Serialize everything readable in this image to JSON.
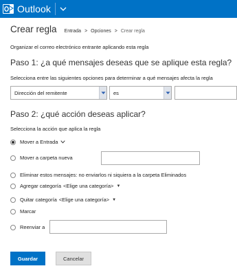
{
  "header": {
    "app_name": "Outlook"
  },
  "page": {
    "title": "Crear regla",
    "breadcrumb": [
      "Entrada",
      "Opciones",
      "Crear regla"
    ],
    "breadcrumb_sep": ">",
    "intro": "Organizar el correo electrónico entrante aplicando esta regla"
  },
  "step1": {
    "heading": "Paso 1: ¿a qué mensajes deseas que se aplique esta regla?",
    "instruction": "Selecciona entre las siguientes opciones para determinar a qué mensajes afecta la regla",
    "field_select": "Dirección del remitente",
    "operator_select": "es",
    "value": ""
  },
  "step2": {
    "heading": "Paso 2: ¿qué acción deseas aplicar?",
    "instruction": "Selecciona la acción que aplica la regla",
    "options": [
      {
        "label": "Mover a Entrada",
        "selected": true
      },
      {
        "label": "Mover a carpeta nueva",
        "selected": false
      },
      {
        "label": "Eliminar estos mensajes: no enviarlos ni siquiera a la carpeta Eliminados",
        "selected": false
      },
      {
        "label": "Agregar categoría",
        "link": "<Elige una categoría>",
        "selected": false
      },
      {
        "label": "Quitar categoría",
        "link": "<Elige una categoría>",
        "selected": false
      },
      {
        "label": "Marcar",
        "selected": false
      },
      {
        "label": "Reenviar a",
        "selected": false
      }
    ]
  },
  "buttons": {
    "save": "Guardar",
    "cancel": "Cancelar"
  },
  "colors": {
    "brand": "#0072c6",
    "cancel_bg": "#e0e0e0"
  },
  "icons": [
    "outlook-logo-icon",
    "chevron-down-icon",
    "dropdown-arrow-icon",
    "caret-down-icon"
  ]
}
